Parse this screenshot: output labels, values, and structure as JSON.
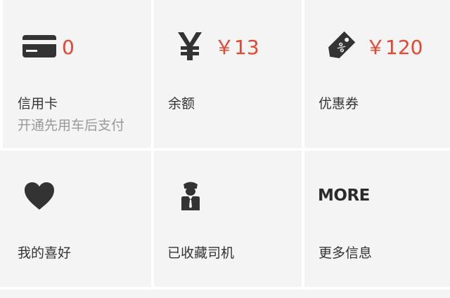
{
  "tiles": {
    "credit_card": {
      "icon": "credit-card-icon",
      "value": "0",
      "label": "信用卡",
      "sublabel": "开通先用车后支付"
    },
    "balance": {
      "icon": "yen-icon",
      "value": "￥13",
      "label": "余额"
    },
    "coupons": {
      "icon": "discount-tag-icon",
      "value": "￥120",
      "label": "优惠券"
    },
    "favorites": {
      "icon": "heart-icon",
      "label": "我的喜好"
    },
    "saved_drivers": {
      "icon": "driver-icon",
      "label": "已收藏司机"
    },
    "more_info": {
      "icon_text": "MORE",
      "label": "更多信息"
    }
  },
  "colors": {
    "accent": "#e8452f",
    "tile_bg": "#f4f4f4",
    "icon": "#333333",
    "label": "#333333",
    "sublabel": "#999999"
  }
}
